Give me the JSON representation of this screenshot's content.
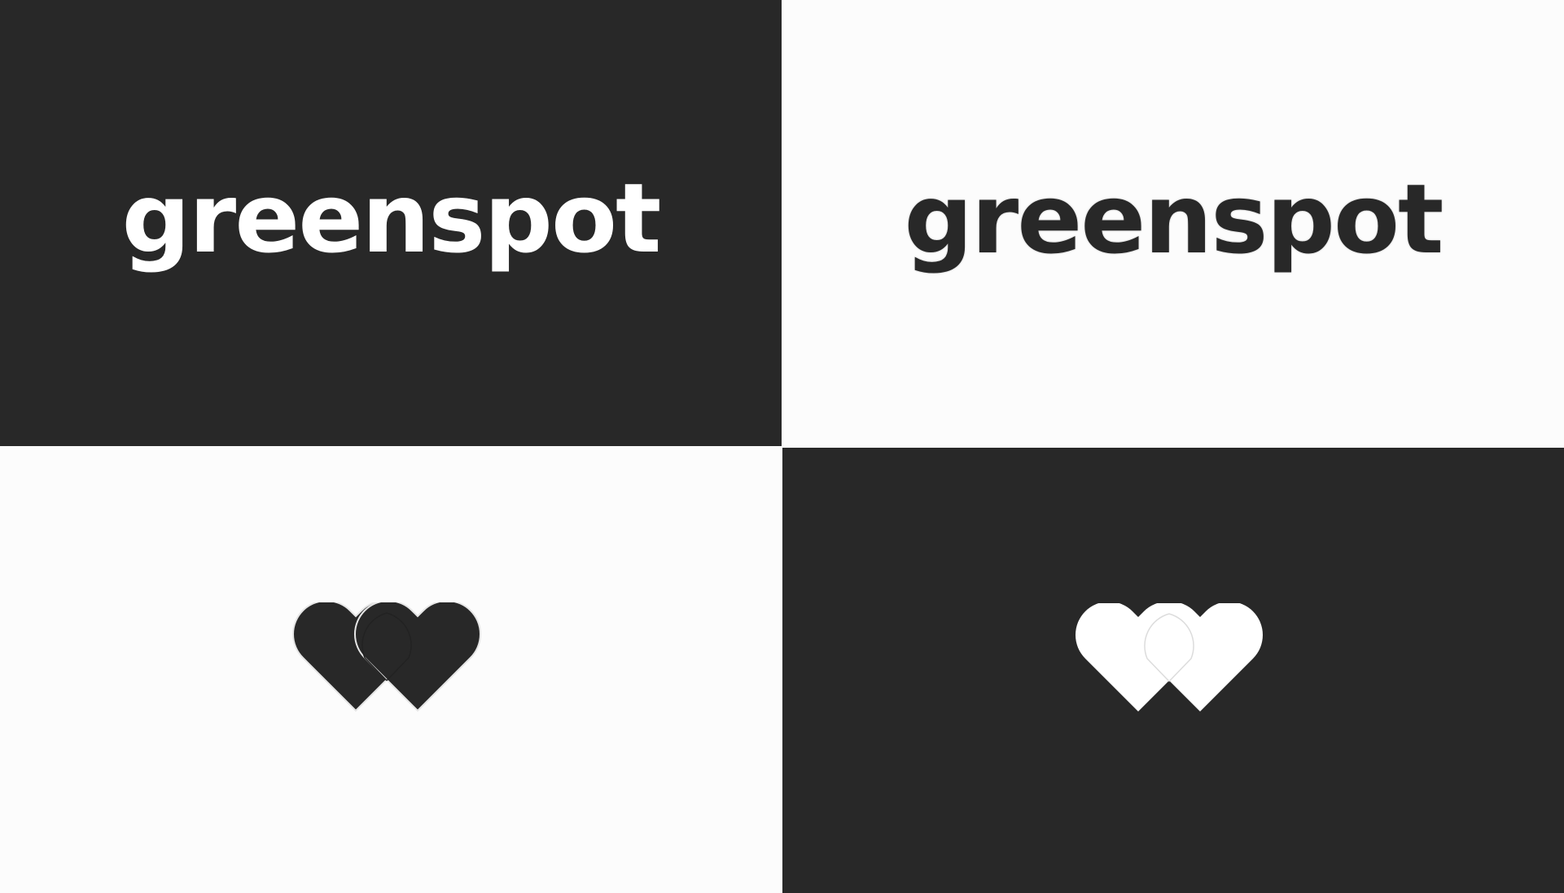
{
  "brand": {
    "wordmark_text": "greenspot",
    "icon": "double-heart-icon"
  },
  "colors": {
    "dark": "#282828",
    "light": "#fcfcfc",
    "white": "#ffffff"
  }
}
